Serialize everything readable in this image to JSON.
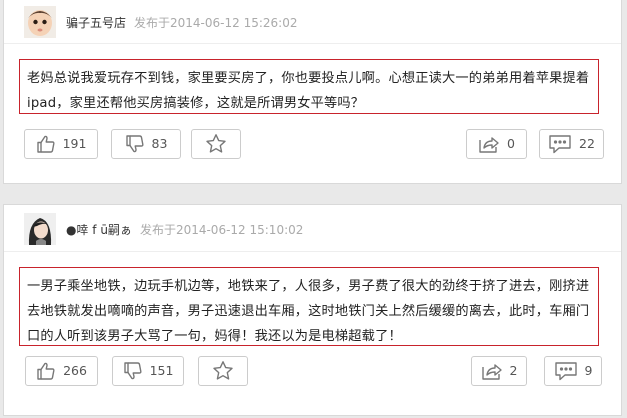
{
  "posts": [
    {
      "username": "骗子五号店",
      "posted": "发布于2014-06-12 15:26:02",
      "content": "老妈总说我爱玩存不到钱，家里要买房了，你也要投点儿啊。心想正读大一的弟弟用着苹果提着ipad，家里还帮他买房搞装修，这就是所谓男女平等吗？",
      "likes": "191",
      "dislikes": "83",
      "shares": "0",
      "comments": "22"
    },
    {
      "username": "●啈 f ū嗣ぁ",
      "posted": "发布于2014-06-12 15:10:02",
      "content": "一男子乘坐地铁，边玩手机边等，地铁来了，人很多，男子费了很大的劲终于挤了进去，刚挤进去地铁就发出嘀嘀的声音，男子迅速退出车厢，这时地铁门关上然后缓缓的离去，此时，车厢门口的人听到该男子大骂了一句，妈得！我还以为是电梯超载了！",
      "likes": "266",
      "dislikes": "151",
      "shares": "2",
      "comments": "9"
    }
  ],
  "colors": {
    "highlight_border": "#c8232c",
    "icon": "#777777"
  },
  "icons": [
    "avatar-baby",
    "avatar-woman",
    "thumbs-up-icon",
    "thumbs-down-icon",
    "star-icon",
    "share-icon",
    "comment-icon"
  ]
}
